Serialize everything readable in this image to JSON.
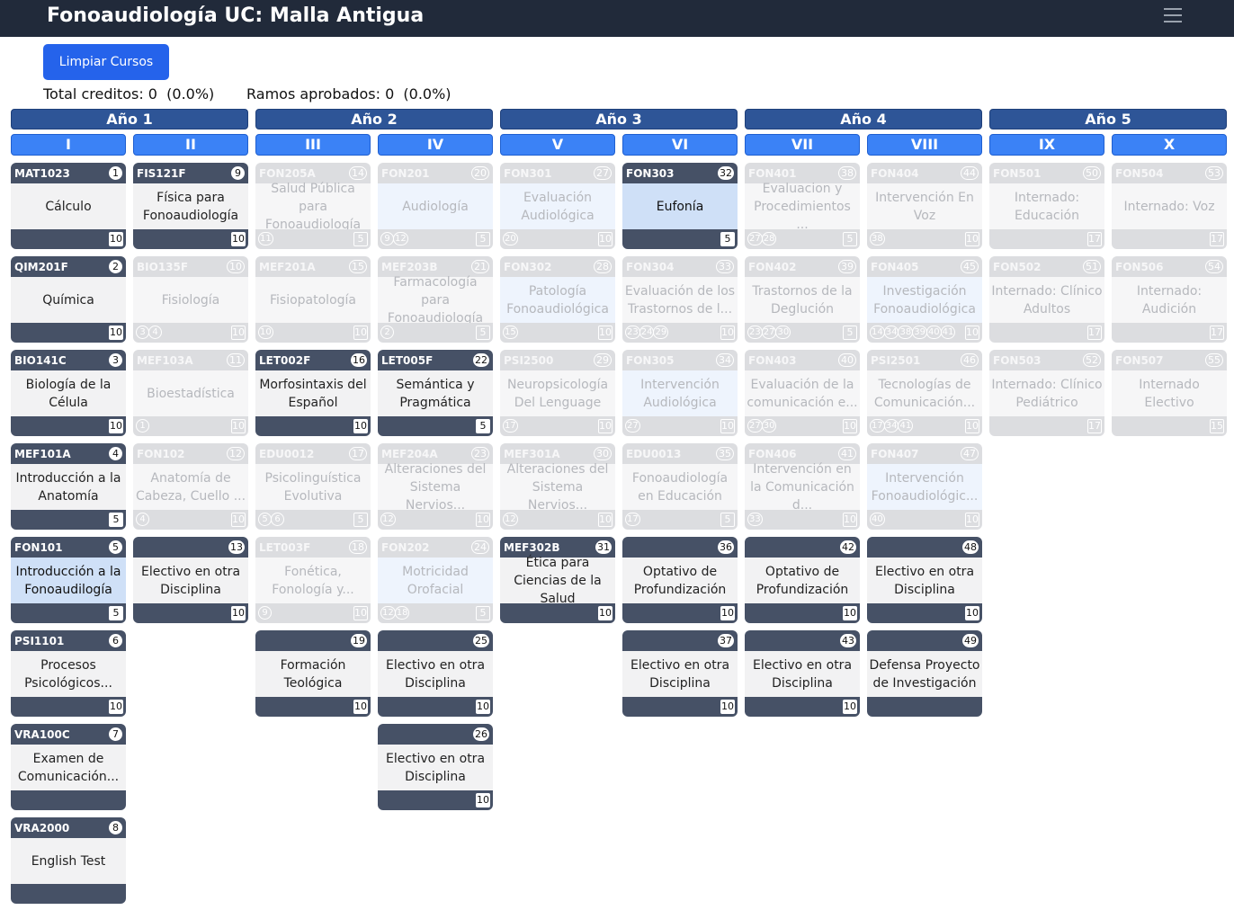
{
  "header": {
    "title": "Fonoaudiología UC: Malla Antigua",
    "menu_icon": "hamburger-menu-icon"
  },
  "toolbar": {
    "clear_label": "Limpiar Cursos"
  },
  "stats": {
    "total_creditos": "Total creditos: 0  (0.0%)",
    "ramos_aprobados": "Ramos aprobados: 0  (0.0%)"
  },
  "years": [
    "Año 1",
    "Año 2",
    "Año 3",
    "Año 4",
    "Año 5"
  ],
  "semesters": [
    "I",
    "II",
    "III",
    "IV",
    "V",
    "VI",
    "VII",
    "VIII",
    "IX",
    "X"
  ],
  "courses": [
    {
      "sem": 0,
      "row": 0,
      "code": "MAT1023",
      "num": "1",
      "name": "Cálculo",
      "credits": "10",
      "prereqs": [],
      "state": "open"
    },
    {
      "sem": 0,
      "row": 1,
      "code": "QIM201F",
      "num": "2",
      "name": "Química",
      "credits": "10",
      "prereqs": [],
      "state": "open"
    },
    {
      "sem": 0,
      "row": 2,
      "code": "BIO141C",
      "num": "3",
      "name": "Biología de la Célula",
      "credits": "10",
      "prereqs": [],
      "state": "open"
    },
    {
      "sem": 0,
      "row": 3,
      "code": "MEF101A",
      "num": "4",
      "name": "Introducción a la Anatomía",
      "credits": "5",
      "prereqs": [],
      "state": "open"
    },
    {
      "sem": 0,
      "row": 4,
      "code": "FON101",
      "num": "5",
      "name": "Introducción a la Fonoaudilogía",
      "credits": "5",
      "prereqs": [],
      "state": "sel"
    },
    {
      "sem": 0,
      "row": 5,
      "code": "PSI1101",
      "num": "6",
      "name": "Procesos Psicológicos...",
      "credits": "10",
      "prereqs": [],
      "state": "open"
    },
    {
      "sem": 0,
      "row": 6,
      "code": "VRA100C",
      "num": "7",
      "name": "Examen de Comunicación...",
      "credits": "",
      "prereqs": [],
      "state": "open"
    },
    {
      "sem": 0,
      "row": 7,
      "code": "VRA2000",
      "num": "8",
      "name": "English Test",
      "credits": "",
      "prereqs": [],
      "state": "open"
    },
    {
      "sem": 1,
      "row": 0,
      "code": "FIS121F",
      "num": "9",
      "name": "Física para Fonoaudiología",
      "credits": "10",
      "prereqs": [],
      "state": "open"
    },
    {
      "sem": 1,
      "row": 1,
      "code": "BIO135F",
      "num": "10",
      "name": "Fisiología",
      "credits": "10",
      "prereqs": [
        "3",
        "4"
      ],
      "state": "locked"
    },
    {
      "sem": 1,
      "row": 2,
      "code": "MEF103A",
      "num": "11",
      "name": "Bioestadística",
      "credits": "10",
      "prereqs": [
        "1"
      ],
      "state": "locked"
    },
    {
      "sem": 1,
      "row": 3,
      "code": "FON102",
      "num": "12",
      "name": "Anatomía de Cabeza, Cuello ...",
      "credits": "10",
      "prereqs": [
        "4"
      ],
      "state": "locked"
    },
    {
      "sem": 1,
      "row": 4,
      "code": "",
      "num": "13",
      "name": "Electivo en otra Disciplina",
      "credits": "10",
      "prereqs": [],
      "state": "open"
    },
    {
      "sem": 2,
      "row": 0,
      "code": "FON205A",
      "num": "14",
      "name": "Salud Pública para Fonoaudiología",
      "credits": "5",
      "prereqs": [
        "11"
      ],
      "state": "locked"
    },
    {
      "sem": 2,
      "row": 1,
      "code": "MEF201A",
      "num": "15",
      "name": "Fisiopatología",
      "credits": "10",
      "prereqs": [
        "10"
      ],
      "state": "locked"
    },
    {
      "sem": 2,
      "row": 2,
      "code": "LET002F",
      "num": "16",
      "name": "Morfosintaxis del Español",
      "credits": "10",
      "prereqs": [],
      "state": "open"
    },
    {
      "sem": 2,
      "row": 3,
      "code": "EDU0012",
      "num": "17",
      "name": "Psicolinguística Evolutiva",
      "credits": "5",
      "prereqs": [
        "5",
        "6"
      ],
      "state": "locked"
    },
    {
      "sem": 2,
      "row": 4,
      "code": "LET003F",
      "num": "18",
      "name": "Fonética, Fonología y...",
      "credits": "10",
      "prereqs": [
        "9"
      ],
      "state": "locked"
    },
    {
      "sem": 2,
      "row": 5,
      "code": "",
      "num": "19",
      "name": "Formación Teológica",
      "credits": "10",
      "prereqs": [],
      "state": "open"
    },
    {
      "sem": 3,
      "row": 0,
      "code": "FON201",
      "num": "20",
      "name": "Audiología",
      "credits": "5",
      "prereqs": [
        "9",
        "12"
      ],
      "state": "avail"
    },
    {
      "sem": 3,
      "row": 1,
      "code": "MEF203B",
      "num": "21",
      "name": "Farmacología para Fonoaudiología",
      "credits": "5",
      "prereqs": [
        "2"
      ],
      "state": "locked"
    },
    {
      "sem": 3,
      "row": 2,
      "code": "LET005F",
      "num": "22",
      "name": "Semántica y Pragmática",
      "credits": "5",
      "prereqs": [],
      "state": "open"
    },
    {
      "sem": 3,
      "row": 3,
      "code": "MEF204A",
      "num": "23",
      "name": "Alteraciones del Sistema Nervios...",
      "credits": "10",
      "prereqs": [
        "12"
      ],
      "state": "locked"
    },
    {
      "sem": 3,
      "row": 4,
      "code": "FON202",
      "num": "24",
      "name": "Motricidad Orofacial",
      "credits": "5",
      "prereqs": [
        "12",
        "18"
      ],
      "state": "avail"
    },
    {
      "sem": 3,
      "row": 5,
      "code": "",
      "num": "25",
      "name": "Electivo en otra Disciplina",
      "credits": "10",
      "prereqs": [],
      "state": "open"
    },
    {
      "sem": 3,
      "row": 6,
      "code": "",
      "num": "26",
      "name": "Electivo en otra Disciplina",
      "credits": "10",
      "prereqs": [],
      "state": "open"
    },
    {
      "sem": 4,
      "row": 0,
      "code": "FON301",
      "num": "27",
      "name": "Evaluación Audiológica",
      "credits": "10",
      "prereqs": [
        "20"
      ],
      "state": "avail"
    },
    {
      "sem": 4,
      "row": 1,
      "code": "FON302",
      "num": "28",
      "name": "Patología Fonoaudiológica",
      "credits": "10",
      "prereqs": [
        "15"
      ],
      "state": "avail"
    },
    {
      "sem": 4,
      "row": 2,
      "code": "PSI2500",
      "num": "29",
      "name": "Neuropsicología Del Lenguage",
      "credits": "10",
      "prereqs": [
        "17"
      ],
      "state": "locked"
    },
    {
      "sem": 4,
      "row": 3,
      "code": "MEF301A",
      "num": "30",
      "name": "Alteraciones del Sistema Nervios...",
      "credits": "10",
      "prereqs": [
        "12"
      ],
      "state": "locked"
    },
    {
      "sem": 4,
      "row": 4,
      "code": "MEF302B",
      "num": "31",
      "name": "Ética para Ciencias de la Salud",
      "credits": "10",
      "prereqs": [],
      "state": "open"
    },
    {
      "sem": 5,
      "row": 0,
      "code": "FON303",
      "num": "32",
      "name": "Eufonía",
      "credits": "5",
      "prereqs": [],
      "state": "sel"
    },
    {
      "sem": 5,
      "row": 1,
      "code": "FON304",
      "num": "33",
      "name": "Evaluación de los Trastornos de l...",
      "credits": "10",
      "prereqs": [
        "23",
        "24",
        "29"
      ],
      "state": "locked"
    },
    {
      "sem": 5,
      "row": 2,
      "code": "FON305",
      "num": "34",
      "name": "Intervención Audiológica",
      "credits": "10",
      "prereqs": [
        "27"
      ],
      "state": "avail"
    },
    {
      "sem": 5,
      "row": 3,
      "code": "EDU0013",
      "num": "35",
      "name": "Fonoaudiología en Educación",
      "credits": "5",
      "prereqs": [
        "17"
      ],
      "state": "locked"
    },
    {
      "sem": 5,
      "row": 4,
      "code": "",
      "num": "36",
      "name": "Optativo de Profundización",
      "credits": "10",
      "prereqs": [],
      "state": "open"
    },
    {
      "sem": 5,
      "row": 5,
      "code": "",
      "num": "37",
      "name": "Electivo en otra Disciplina",
      "credits": "10",
      "prereqs": [],
      "state": "open"
    },
    {
      "sem": 6,
      "row": 0,
      "code": "FON401",
      "num": "38",
      "name": "Evaluacion y Procedimientos ...",
      "credits": "5",
      "prereqs": [
        "27",
        "28"
      ],
      "state": "locked"
    },
    {
      "sem": 6,
      "row": 1,
      "code": "FON402",
      "num": "39",
      "name": "Trastornos de la Deglución",
      "credits": "5",
      "prereqs": [
        "23",
        "27",
        "30"
      ],
      "state": "locked"
    },
    {
      "sem": 6,
      "row": 2,
      "code": "FON403",
      "num": "40",
      "name": "Evaluación de la comunicación e...",
      "credits": "10",
      "prereqs": [
        "27",
        "30"
      ],
      "state": "locked"
    },
    {
      "sem": 6,
      "row": 3,
      "code": "FON406",
      "num": "41",
      "name": "Intervención en la Comunicación d...",
      "credits": "10",
      "prereqs": [
        "33"
      ],
      "state": "locked"
    },
    {
      "sem": 6,
      "row": 4,
      "code": "",
      "num": "42",
      "name": "Optativo de Profundización",
      "credits": "10",
      "prereqs": [],
      "state": "open"
    },
    {
      "sem": 6,
      "row": 5,
      "code": "",
      "num": "43",
      "name": "Electivo en otra Disciplina",
      "credits": "10",
      "prereqs": [],
      "state": "open"
    },
    {
      "sem": 7,
      "row": 0,
      "code": "FON404",
      "num": "44",
      "name": "Intervención En Voz",
      "credits": "10",
      "prereqs": [
        "38"
      ],
      "state": "locked"
    },
    {
      "sem": 7,
      "row": 1,
      "code": "FON405",
      "num": "45",
      "name": "Investigación Fonoaudiológica",
      "credits": "10",
      "prereqs": [
        "14",
        "34",
        "38",
        "39",
        "40",
        "41"
      ],
      "state": "avail"
    },
    {
      "sem": 7,
      "row": 2,
      "code": "PSI2501",
      "num": "46",
      "name": "Tecnologías de Comunicación...",
      "credits": "10",
      "prereqs": [
        "17",
        "34",
        "41"
      ],
      "state": "locked"
    },
    {
      "sem": 7,
      "row": 3,
      "code": "FON407",
      "num": "47",
      "name": "Intervención Fonoaudiológic...",
      "credits": "10",
      "prereqs": [
        "40"
      ],
      "state": "avail"
    },
    {
      "sem": 7,
      "row": 4,
      "code": "",
      "num": "48",
      "name": "Electivo en otra Disciplina",
      "credits": "10",
      "prereqs": [],
      "state": "open"
    },
    {
      "sem": 7,
      "row": 5,
      "code": "",
      "num": "49",
      "name": "Defensa Proyecto de Investigación",
      "credits": "",
      "prereqs": [],
      "state": "open"
    },
    {
      "sem": 8,
      "row": 0,
      "code": "FON501",
      "num": "50",
      "name": "Internado: Educación",
      "credits": "17",
      "prereqs": [],
      "state": "locked"
    },
    {
      "sem": 8,
      "row": 1,
      "code": "FON502",
      "num": "51",
      "name": "Internado: Clínico Adultos",
      "credits": "17",
      "prereqs": [],
      "state": "locked"
    },
    {
      "sem": 8,
      "row": 2,
      "code": "FON503",
      "num": "52",
      "name": "Internado: Clínico Pediátrico",
      "credits": "17",
      "prereqs": [],
      "state": "locked"
    },
    {
      "sem": 9,
      "row": 0,
      "code": "FON504",
      "num": "53",
      "name": "Internado: Voz",
      "credits": "17",
      "prereqs": [],
      "state": "locked"
    },
    {
      "sem": 9,
      "row": 1,
      "code": "FON506",
      "num": "54",
      "name": "Internado: Audición",
      "credits": "17",
      "prereqs": [],
      "state": "locked"
    },
    {
      "sem": 9,
      "row": 2,
      "code": "FON507",
      "num": "55",
      "name": "Internado Electivo",
      "credits": "15",
      "prereqs": [],
      "state": "locked"
    }
  ]
}
